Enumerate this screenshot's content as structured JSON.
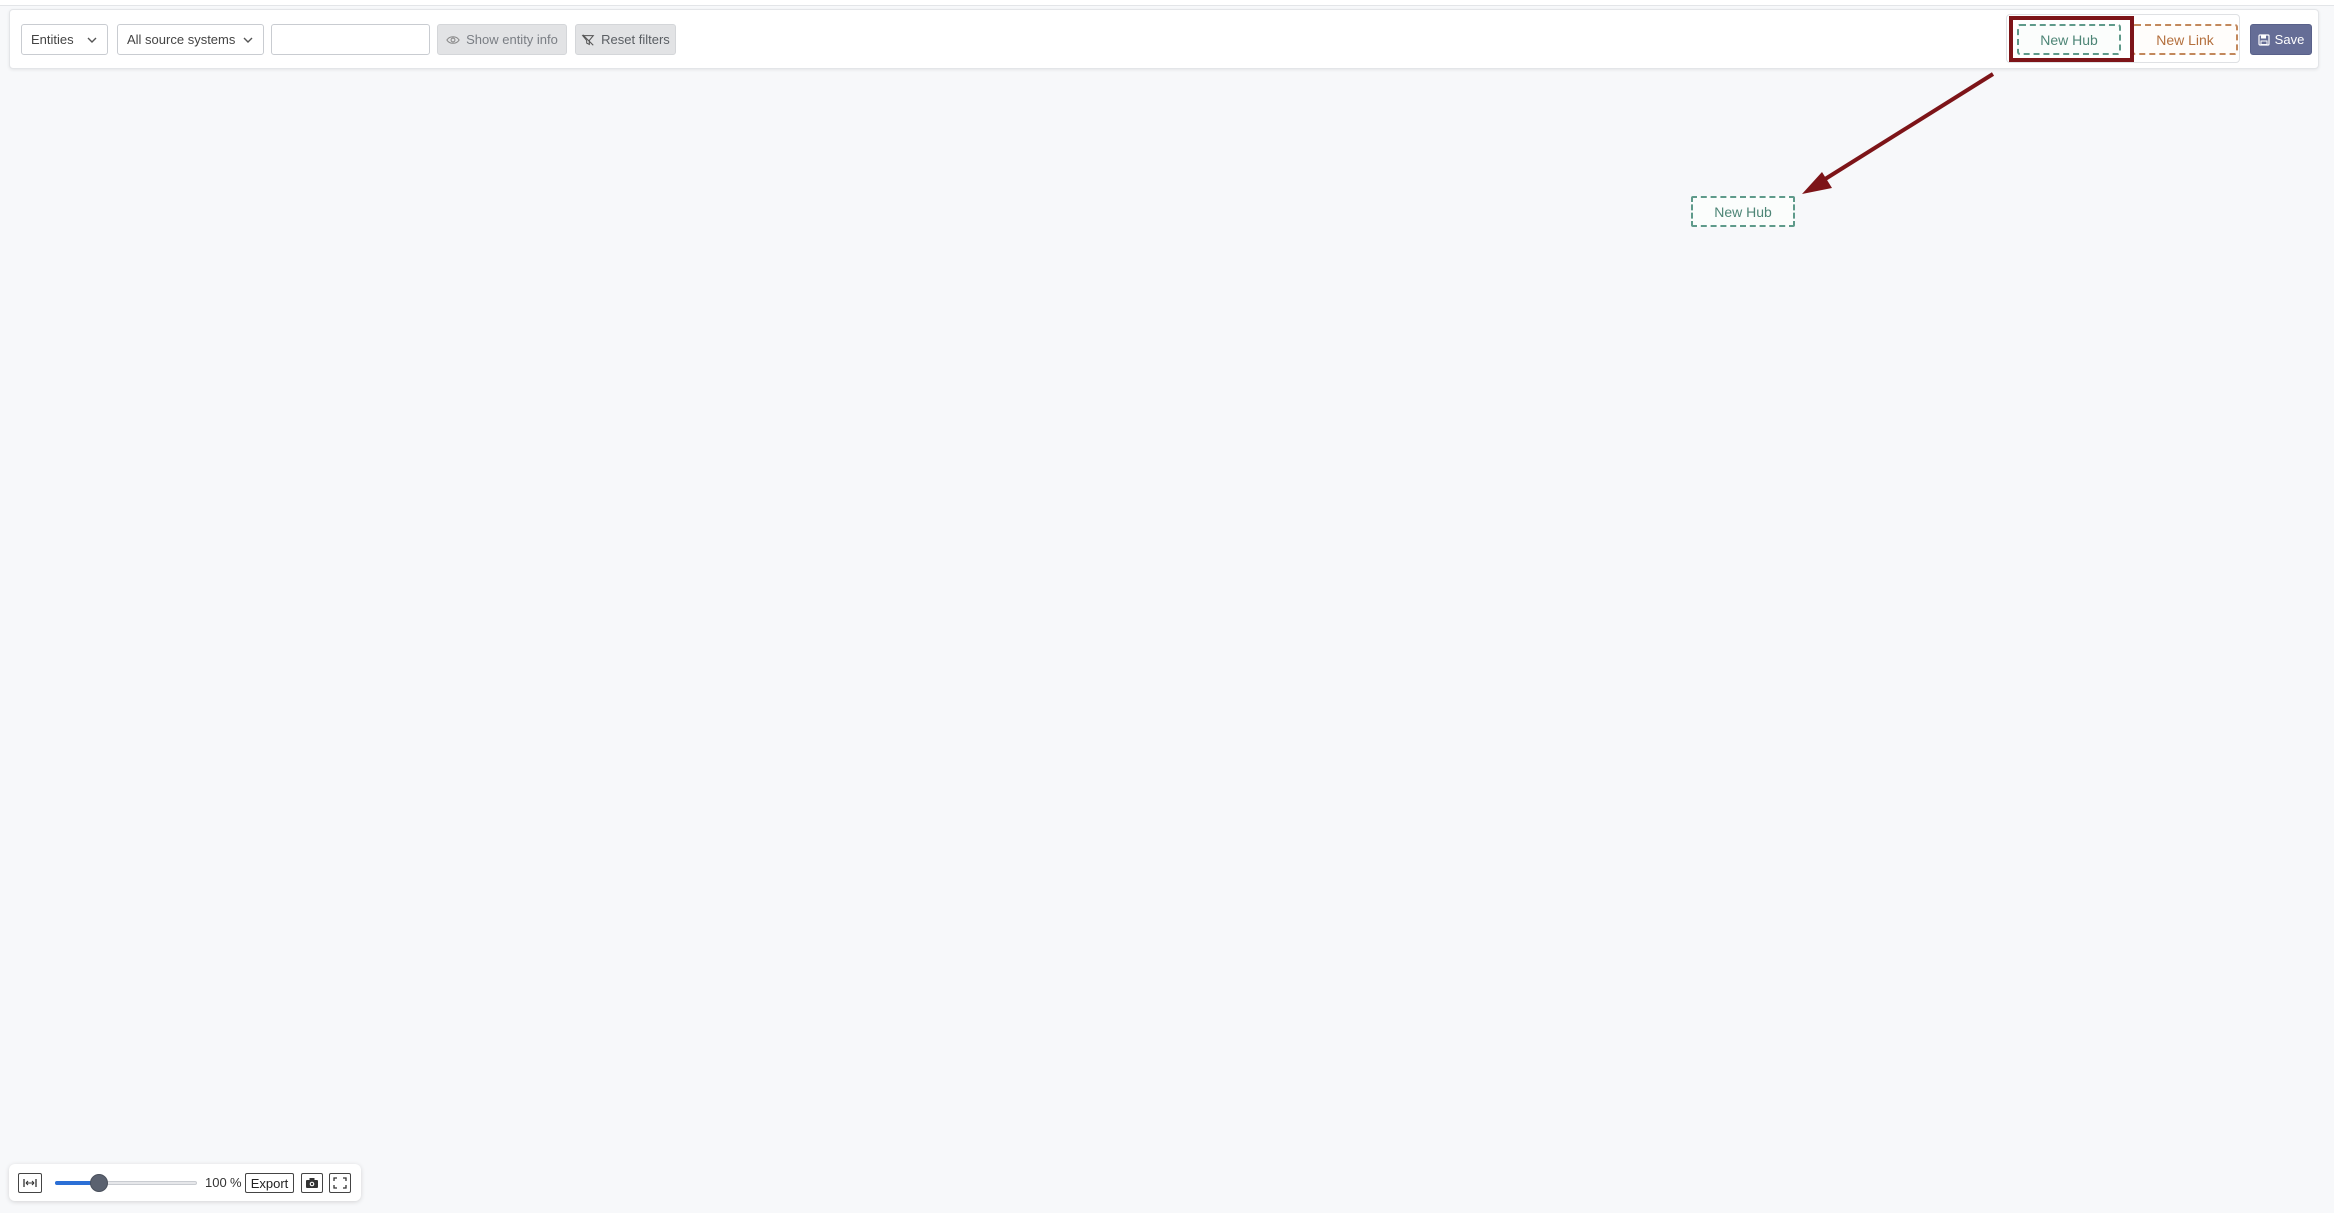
{
  "toolbar": {
    "entity_type_select": {
      "value": "Entities"
    },
    "source_system_select": {
      "value": "All source systems"
    },
    "search_input": {
      "value": "",
      "placeholder": ""
    },
    "show_entity_info_label": "Show entity info",
    "reset_filters_label": "Reset filters",
    "new_hub_label": "New Hub",
    "new_link_label": "New Link",
    "save_label": "Save"
  },
  "canvas": {
    "nodes": [
      {
        "type": "hub",
        "label": "New Hub"
      }
    ],
    "annotation": {
      "highlight_target": "new-hub-button",
      "arrow_color": "#7d1418"
    }
  },
  "zoom_controls": {
    "zoom_percent": 100,
    "zoom_value": "100",
    "zoom_unit": "%",
    "zoom_min": 10,
    "zoom_max": 300,
    "export_label": "Export"
  },
  "colors": {
    "hub_accent": "#4d8576",
    "link_accent": "#b4703e",
    "save_bg": "#656d96",
    "slider_fill": "#2b6fd6"
  },
  "icons": {
    "show_entity_info": "eye-icon",
    "reset_filters": "filter-off-icon",
    "save": "floppy-disk-icon",
    "fit": "fit-width-icon",
    "camera": "camera-icon",
    "fullscreen": "fullscreen-icon",
    "dropdown": "chevron-down-icon"
  }
}
